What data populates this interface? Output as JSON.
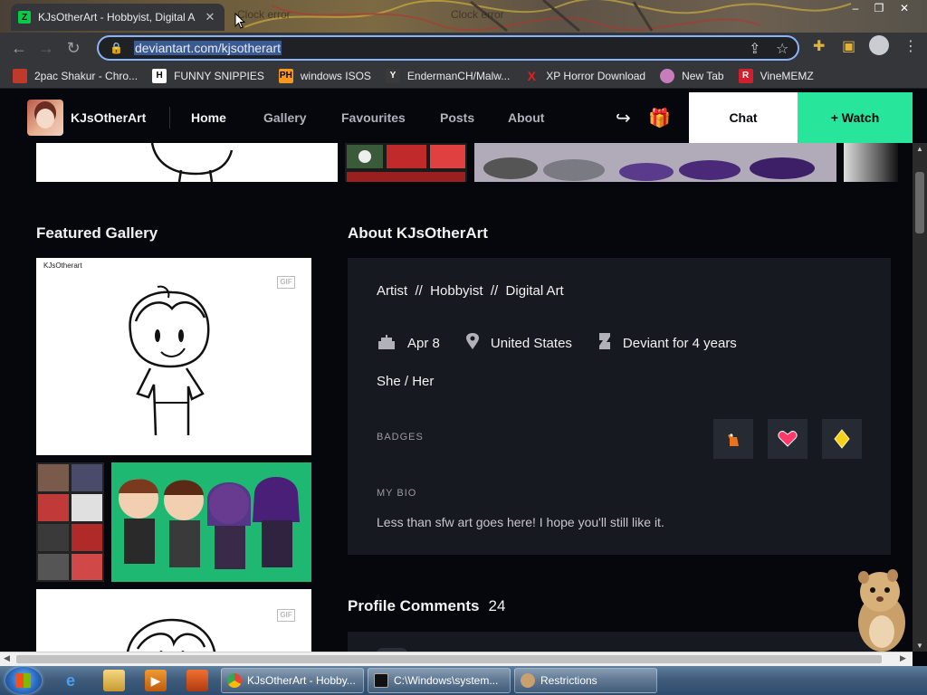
{
  "browser": {
    "active_tab_title": "KJsOtherArt - Hobbyist, Digital A",
    "ghost_tab_1": "Clock error",
    "ghost_tab_2": "Clock error",
    "url": "deviantart.com/kjsotherart",
    "close_glyph": "✕"
  },
  "bookmarks": [
    {
      "label": "2pac Shakur - Chro...",
      "icon": "briefcase-icon",
      "color": "#e8eaed"
    },
    {
      "label": "FUNNY SNIPPIES",
      "icon": "h-icon",
      "color": "#ffffff"
    },
    {
      "label": "windows ISOS",
      "icon": "ph-icon",
      "color": "#f7971d"
    },
    {
      "label": "EndermanCH/Malw...",
      "icon": "yp-icon",
      "color": "#3a3a3a"
    },
    {
      "label": "XP Horror Download",
      "icon": "x-icon",
      "color": "#e02020"
    },
    {
      "label": "New Tab",
      "icon": "globe-icon",
      "color": "#c77dbb"
    },
    {
      "label": "VineMEMZ",
      "icon": "r-icon",
      "color": "#d0202e"
    }
  ],
  "site": {
    "name": "KJsOtherArt",
    "nav": [
      "Home",
      "Gallery",
      "Favourites",
      "Posts",
      "About"
    ],
    "chat_label": "Chat",
    "watch_label": "+ Watch",
    "accent_color": "#27e59b"
  },
  "featured": {
    "title": "Featured Gallery",
    "sketch_signature": "KJsOtherart",
    "gif_label": "GIF"
  },
  "about": {
    "title": "About KJsOtherArt",
    "tags": "Artist  //  Hobbyist  //  Digital Art",
    "birthday": "Apr 8",
    "location": "United States",
    "deviant_since": "Deviant for 4 years",
    "pronouns": "She / Her",
    "badges_label": "BADGES",
    "badges": [
      "llama-badge-icon",
      "heart-badge-icon",
      "diamond-badge-icon"
    ],
    "bio_label": "MY BIO",
    "bio": "Less than sfw art goes here! I hope you'll still like it."
  },
  "comments": {
    "title": "Profile Comments",
    "count": "24"
  },
  "taskbar": {
    "items": [
      {
        "label": "KJsOtherArt - Hobby...",
        "icon": "chrome-icon"
      },
      {
        "label": "C:\\Windows\\system...",
        "icon": "cmd-icon"
      },
      {
        "label": "Restrictions",
        "icon": "restrictions-icon"
      }
    ]
  }
}
